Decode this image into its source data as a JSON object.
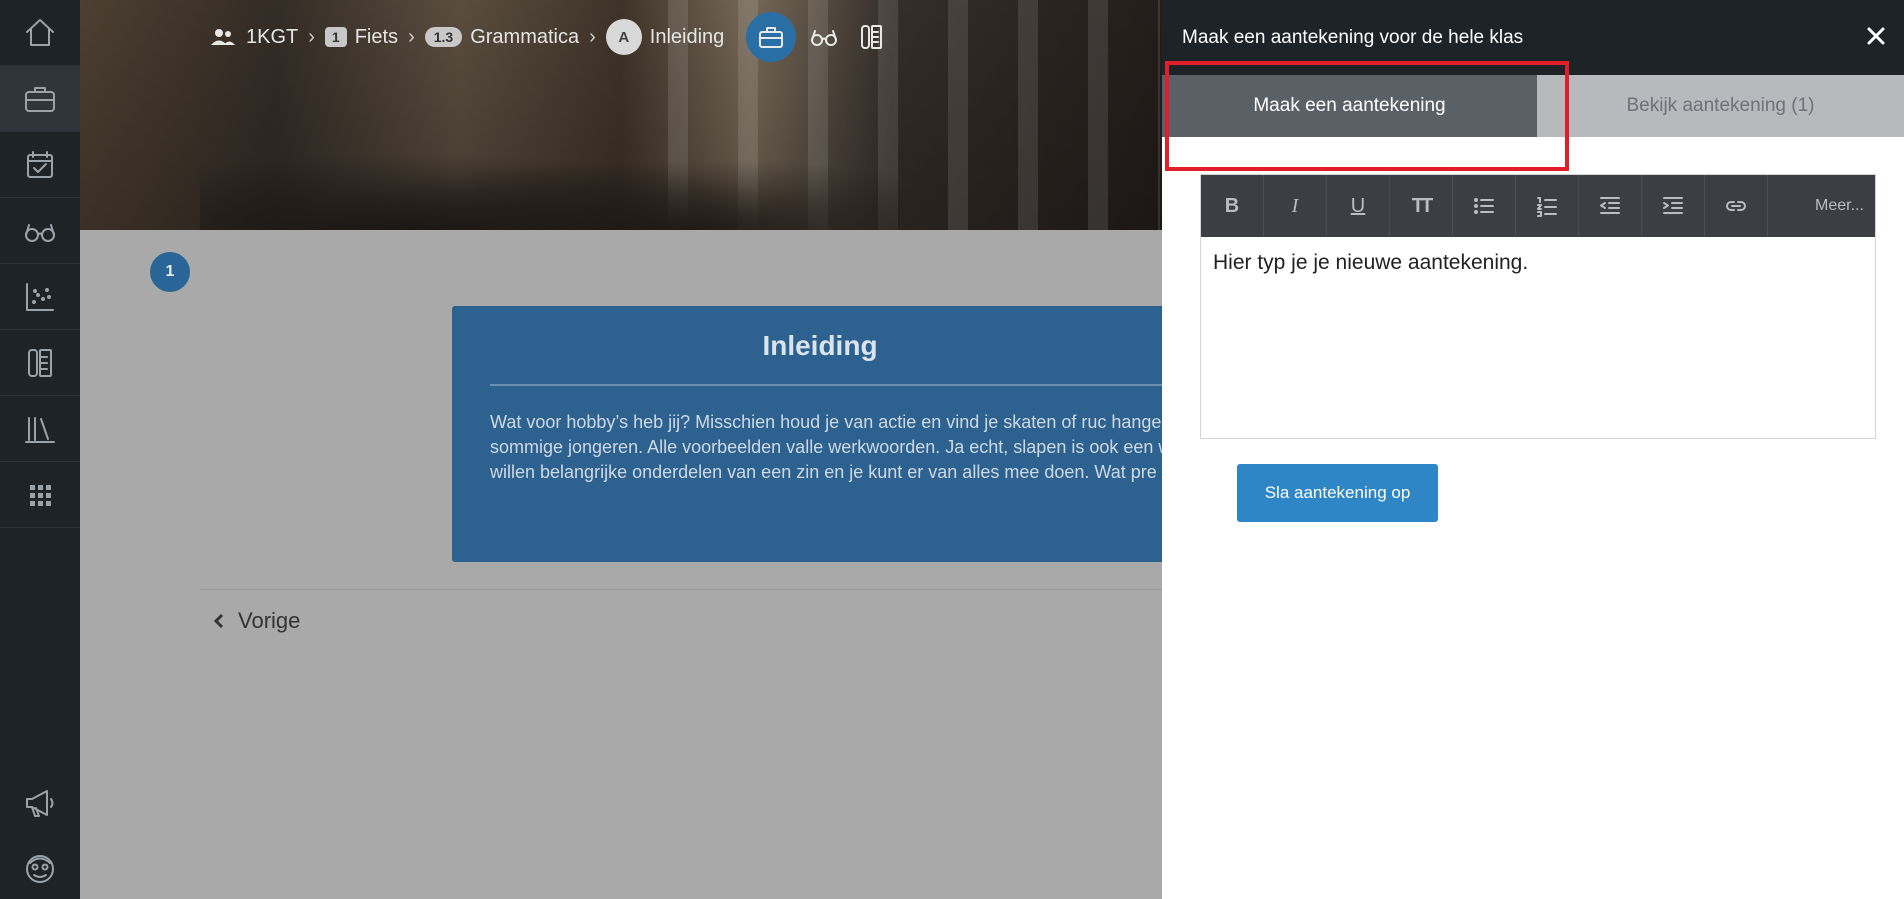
{
  "sidebar": {
    "items": [
      {
        "icon": "home-icon"
      },
      {
        "icon": "briefcase-icon",
        "active": true
      },
      {
        "icon": "calendar-check-icon"
      },
      {
        "icon": "glasses-icon"
      },
      {
        "icon": "scatter-chart-icon"
      },
      {
        "icon": "notebook-icon"
      },
      {
        "icon": "library-icon"
      },
      {
        "icon": "apps-grid-icon"
      }
    ],
    "bottom": [
      {
        "icon": "megaphone-icon"
      },
      {
        "icon": "avatar-icon"
      }
    ]
  },
  "breadcrumb": {
    "class": "1KGT",
    "chapter_num": "1",
    "chapter": "Fiets",
    "section_num": "1.3",
    "section": "Grammatica",
    "lesson_letter": "A",
    "lesson": "Inleiding"
  },
  "main": {
    "step": "1",
    "card_title": "Inleiding",
    "card_text": "Wat voor hobby’s heb jij? Misschien houd je van actie en vind je skaten of ruc hangen zijn populaire hobby’s van sommige jongeren. Alle voorbeelden valle werkwoorden. Ja echt, slapen is ook een werkwoord. Net als hebben, willen belangrijke onderdelen van een zin en je kunt er van alles mee doen. Wat pre paragraaf.",
    "prev_label": "Vorige"
  },
  "panel": {
    "title": "Maak een aantekening voor de hele klas",
    "tabs": [
      "Maak een aantekening",
      "Bekijk aantekening (1)"
    ],
    "toolbar_more": "Meer...",
    "toolbar_bold": "B",
    "toolbar_italic": "I",
    "toolbar_underline": "U",
    "toolbar_size": "TT",
    "editor_text": "Hier typ je je nieuwe aantekening.",
    "save_label": "Sla aantekening op"
  },
  "colors": {
    "accent": "#2e86c6",
    "sidebar_bg": "#1e2327",
    "highlight": "#e21e2a"
  }
}
